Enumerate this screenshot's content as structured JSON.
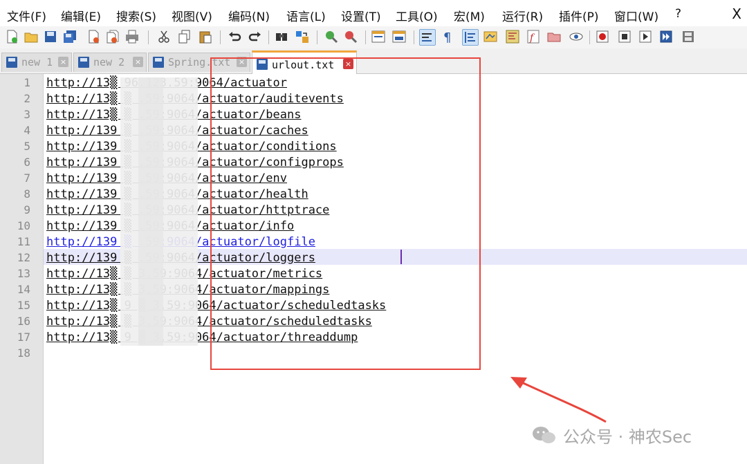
{
  "menubar": {
    "items": [
      "文件(F)",
      "编辑(E)",
      "搜索(S)",
      "视图(V)",
      "编码(N)",
      "语言(L)",
      "设置(T)",
      "工具(O)",
      "宏(M)",
      "运行(R)",
      "插件(P)",
      "窗口(W)",
      "?"
    ],
    "close": "X"
  },
  "toolbar": {
    "icons": [
      "new-file-icon",
      "open-file-icon",
      "save-icon",
      "save-all-icon",
      "close-icon",
      "close-all-icon",
      "print-icon",
      "cut-icon",
      "copy-icon",
      "paste-icon",
      "undo-icon",
      "redo-icon",
      "find-icon",
      "replace-icon",
      "zoom-in-icon",
      "zoom-out-icon",
      "sync-vertical-icon",
      "sync-horizontal-icon",
      "word-wrap-icon",
      "show-all-chars-icon",
      "indent-guide-icon",
      "udl-icon",
      "doc-map-icon",
      "function-list-icon",
      "folder-workspace-icon",
      "monitoring-icon",
      "record-macro-icon",
      "stop-macro-icon",
      "play-macro-icon",
      "run-macro-multiple-icon",
      "save-macro-icon"
    ]
  },
  "tabs": [
    {
      "label": "new 1",
      "active": false,
      "close": "×"
    },
    {
      "label": "new 2",
      "active": false,
      "close": "×"
    },
    {
      "label": "Spring.txt",
      "active": false,
      "close": "×"
    },
    {
      "label": "urlout.txt",
      "active": true,
      "close": "×"
    }
  ],
  "editor": {
    "line_numbers": [
      "1",
      "2",
      "3",
      "4",
      "5",
      "6",
      "7",
      "8",
      "9",
      "10",
      "11",
      "12",
      "13",
      "14",
      "15",
      "16",
      "17",
      "18"
    ],
    "lines": [
      "http://13▒ 96.123.59:9064/actuator",
      "http://13▒ ▒ .59:9064/actuator/auditevents",
      "http://13▒ ▒ .59:9064/actuator/beans",
      "http://139 ▒ .59:9064/actuator/caches",
      "http://139 ▒ .59:9064/actuator/conditions",
      "http://139 ▒ .59:9064/actuator/configprops",
      "http://139 ▒ .59:9064/actuator/env",
      "http://139 ▒ .59:9064/actuator/health",
      "http://139 ▒ .59:9064/actuator/httptrace",
      "http://139 ▒ .59:9064/actuator/info",
      "http://139 ▒ .59:9064/actuator/logfile",
      "http://139 ▒ .59:9064/actuator/loggers",
      "http://13▒ ▒ 3.59:9064/actuator/metrics",
      "http://13▒ ▒ 3.59:9064/actuator/mappings",
      "http://13▒ 9 ▒ 3.59:9064/actuator/scheduledtasks",
      "http://13▒ ▒ 3.59:9064/actuator/scheduledtasks",
      "http://13▒ 9 ▒ 3.59:9064/actuator/threaddump",
      ""
    ],
    "current_line": 12,
    "link_hover_line": 11
  },
  "watermark": {
    "text": "公众号 · 神农Sec"
  },
  "colors": {
    "annotation_red": "#e8453c",
    "active_tab_accent": "#f2a53c",
    "current_line_bg": "#e8e8fb"
  }
}
